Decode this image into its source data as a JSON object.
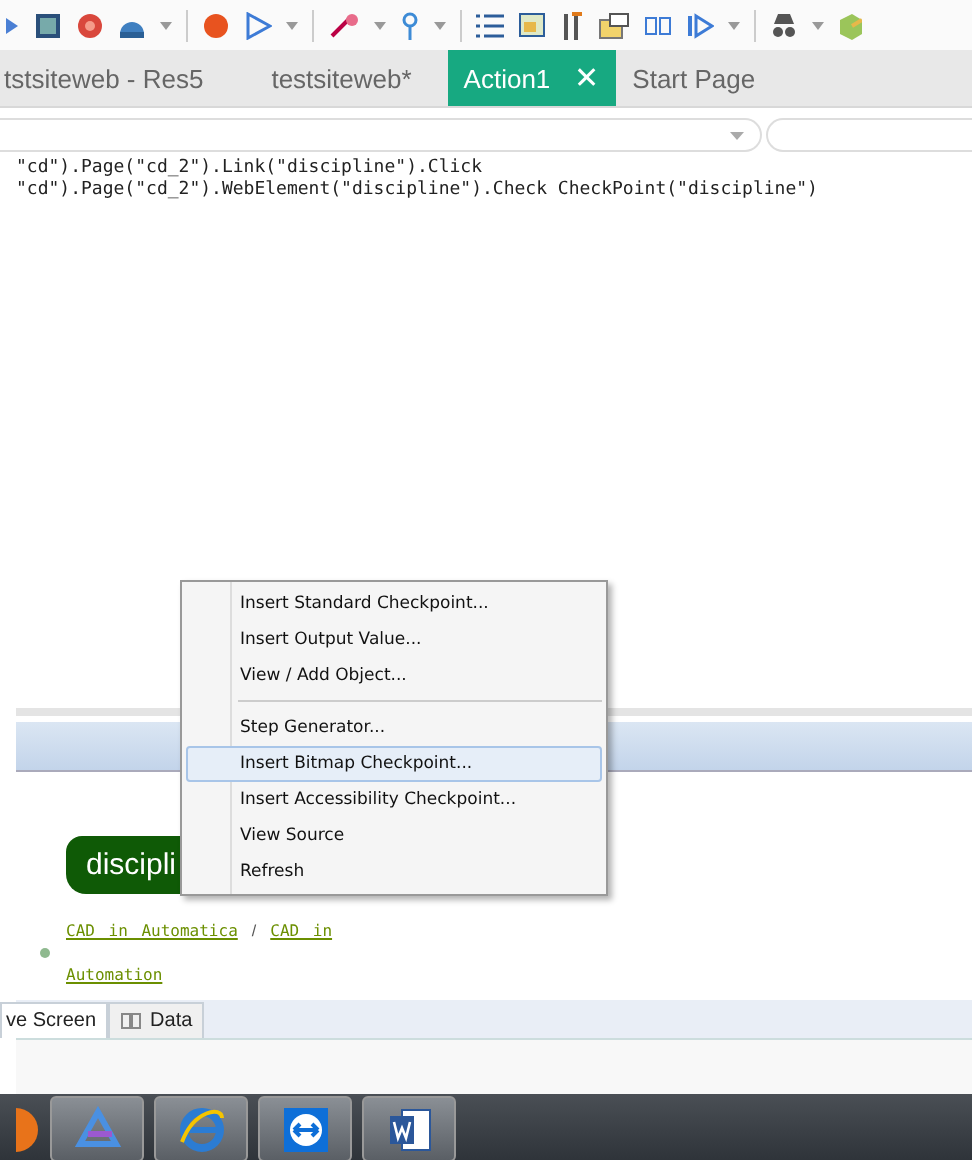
{
  "tabs": [
    {
      "label": "tstsiteweb - Res5",
      "selected": false,
      "closable": false
    },
    {
      "label": "testsiteweb*",
      "selected": false,
      "closable": false
    },
    {
      "label": "Action1",
      "selected": true,
      "closable": true
    },
    {
      "label": "Start Page",
      "selected": false,
      "closable": false
    }
  ],
  "close_glyph": "✕",
  "code_lines": [
    "\"cd\").Page(\"cd_2\").Link(\"discipline\").Click",
    "\"cd\").Page(\"cd_2\").WebElement(\"discipline\").Check CheckPoint(\"discipline\")"
  ],
  "preview": {
    "heading": "discipli",
    "links": [
      "CAD in Automatica",
      "CAD in",
      "Automation"
    ],
    "link_separator": "/"
  },
  "bottom_tabs": [
    {
      "label": "ve Screen",
      "selected": true
    },
    {
      "label": "Data",
      "selected": false
    }
  ],
  "context_menu": [
    {
      "kind": "item",
      "label": "Insert Standard Checkpoint...",
      "selected": false
    },
    {
      "kind": "item",
      "label": "Insert Output Value...",
      "selected": false
    },
    {
      "kind": "item",
      "label": "View / Add Object...",
      "selected": false
    },
    {
      "kind": "separator"
    },
    {
      "kind": "item",
      "label": "Step Generator...",
      "selected": false
    },
    {
      "kind": "item",
      "label": "Insert Bitmap Checkpoint...",
      "selected": true
    },
    {
      "kind": "item",
      "label": "Insert Accessibility Checkpoint...",
      "selected": false
    },
    {
      "kind": "item",
      "label": "View Source",
      "selected": false
    },
    {
      "kind": "item",
      "label": "Refresh",
      "selected": false
    }
  ]
}
